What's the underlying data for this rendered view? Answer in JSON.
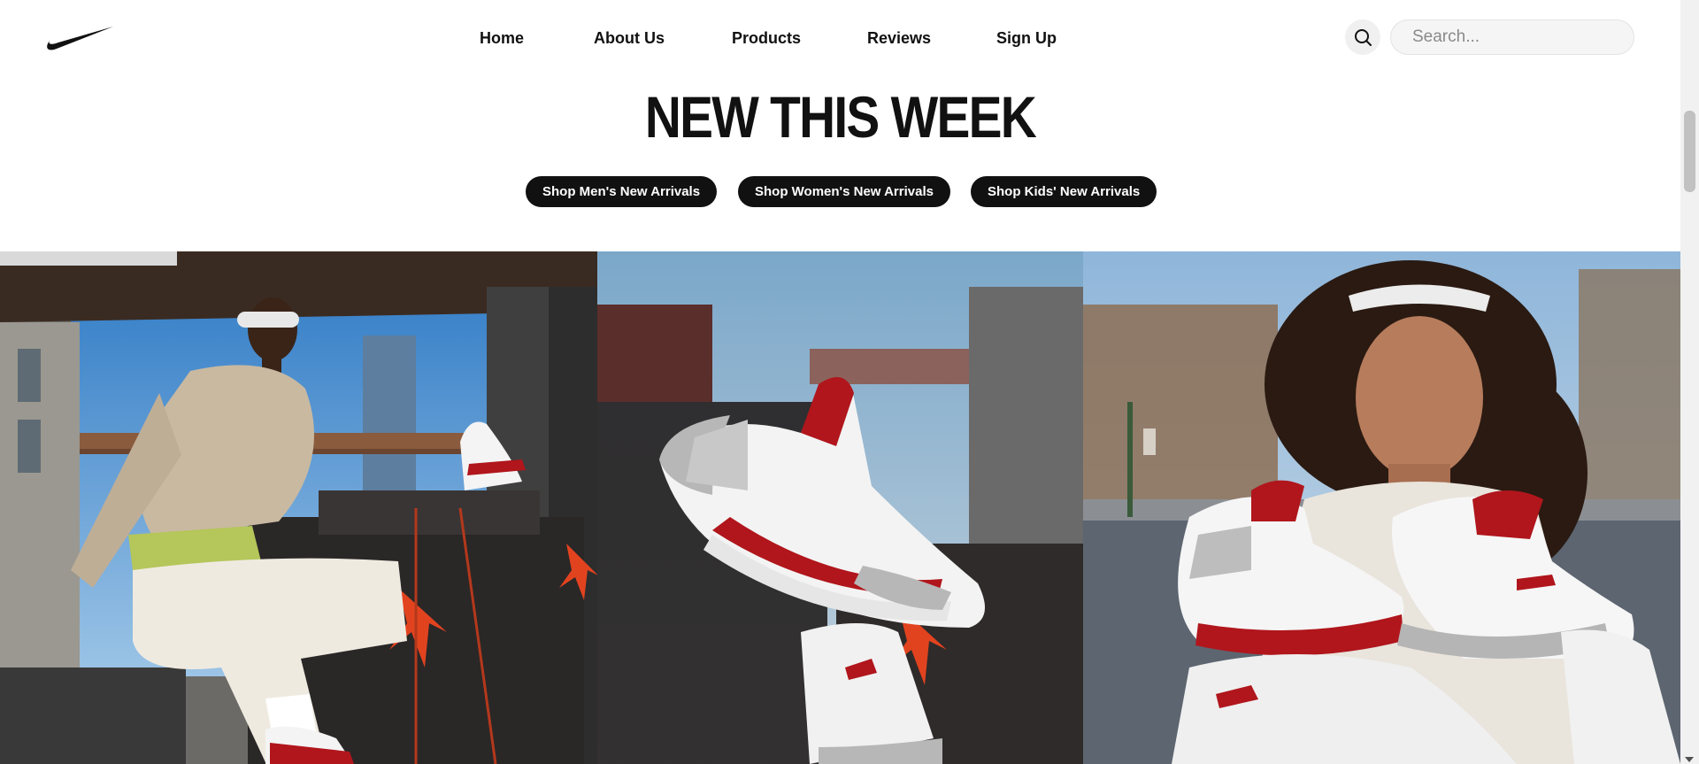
{
  "brand": {
    "logo_icon": "nike-swoosh-icon"
  },
  "nav": {
    "items": [
      {
        "label": "Home"
      },
      {
        "label": "About Us"
      },
      {
        "label": "Products"
      },
      {
        "label": "Reviews"
      },
      {
        "label": "Sign Up"
      }
    ]
  },
  "search": {
    "icon": "search-icon",
    "placeholder": "Search...",
    "value": ""
  },
  "hero": {
    "title": "NEW THIS WEEK",
    "buttons": [
      {
        "label": "Shop Men's New Arrivals"
      },
      {
        "label": "Shop Women's New Arrivals"
      },
      {
        "label": "Shop Kids' New Arrivals"
      }
    ]
  },
  "photos": [
    {
      "subject": "man-on-boxes-photo"
    },
    {
      "subject": "sneaker-closeup-photo"
    },
    {
      "subject": "woman-with-sneakers-photo"
    }
  ],
  "colors": {
    "text": "#111111",
    "button_bg": "#111111",
    "button_text": "#ffffff",
    "sneaker_red": "#b0161c"
  }
}
